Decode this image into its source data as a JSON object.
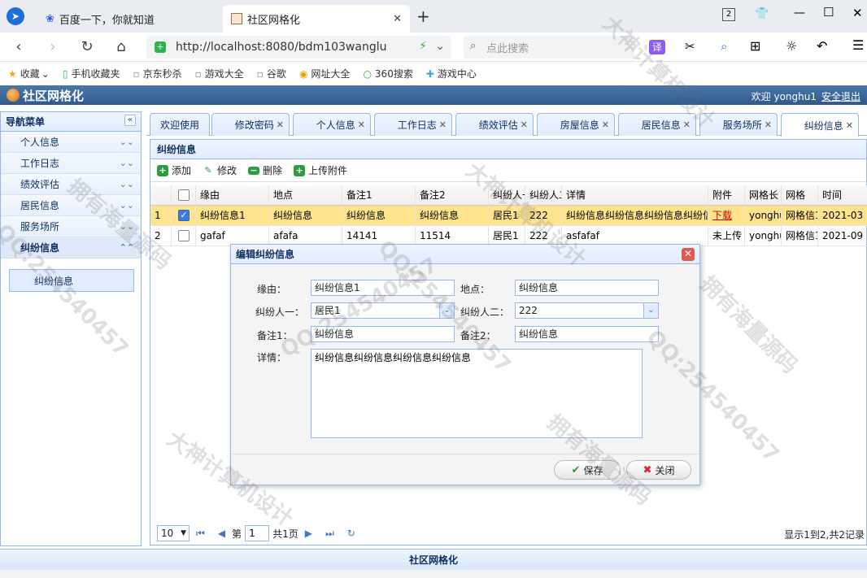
{
  "browser": {
    "tabs": [
      {
        "title": "百度一下，你就知道",
        "close": ""
      },
      {
        "title": "社区网格化",
        "close": "✕"
      }
    ],
    "new_tab": "+",
    "window_buttons": {
      "badge": "2",
      "minimize": "—",
      "maximize": "☐",
      "close": "✕"
    },
    "url": "http://localhost:8080/bdm103wanglu",
    "search_placeholder": "点此搜索",
    "translate": "译",
    "bookmarks": [
      "收藏",
      "手机收藏夹",
      "京东秒杀",
      "游戏大全",
      "谷歌",
      "网址大全",
      "360搜索",
      "游戏中心"
    ]
  },
  "app": {
    "title": "社区网格化",
    "welcome": "欢迎 yonghu1",
    "logout": "安全退出",
    "footer": "社区网格化"
  },
  "sidebar": {
    "header": "导航菜单",
    "collapse": "«",
    "items": [
      "个人信息",
      "工作日志",
      "绩效评估",
      "居民信息",
      "服务场所",
      "纠纷信息"
    ],
    "sub_item": "纠纷信息"
  },
  "tabs": [
    "欢迎使用",
    "修改密码",
    "个人信息",
    "工作日志",
    "绩效评估",
    "房屋信息",
    "居民信息",
    "服务场所",
    "纠纷信息"
  ],
  "tab_close": "✕",
  "panel": {
    "title": "纠纷信息",
    "toolbar": [
      "添加",
      "修改",
      "删除",
      "上传附件"
    ]
  },
  "grid": {
    "columns": [
      "",
      "缘由",
      "地点",
      "备注1",
      "备注2",
      "纠纷人一",
      "纠纷人二",
      "详情",
      "附件",
      "网格长",
      "网格",
      "时间"
    ],
    "rows": [
      {
        "no": "1",
        "checked": true,
        "cells": [
          "纠纷信息1",
          "纠纷信息",
          "纠纷信息",
          "纠纷信息",
          "居民1",
          "222",
          "纠纷信息纠纷信息纠纷信息纠纷信息",
          "下载",
          "yonghu1",
          "网格信1",
          "2021-03"
        ]
      },
      {
        "no": "2",
        "checked": false,
        "cells": [
          "gafaf",
          "afafa",
          "14141",
          "11514",
          "居民1",
          "222",
          "asfafaf",
          "未上传",
          "yonghu1",
          "网格信1",
          "2021-09"
        ]
      }
    ]
  },
  "pager": {
    "page_size": "10",
    "page_label": "第",
    "page_value": "1",
    "total_pages": "共1页",
    "info": "显示1到2,共2记录"
  },
  "dialog": {
    "title": "编辑纠纷信息",
    "close": "✕",
    "fields": {
      "reason_label": "缘由：",
      "reason": "纠纷信息1",
      "place_label": "地点：",
      "place": "纠纷信息",
      "party1_label": "纠纷人一：",
      "party1": "居民1",
      "party2_label": "纠纷人二：",
      "party2": "222",
      "note1_label": "备注1：",
      "note1": "纠纷信息",
      "note2_label": "备注2：",
      "note2": "纠纷信息",
      "detail_label": "详情：",
      "detail": "纠纷信息纠纷信息纠纷信息纠纷信息"
    },
    "save": "保存",
    "cancel": "关闭"
  },
  "watermarks": [
    "QQ:254540457",
    "大神计算机设计",
    "拥有海量源码",
    "QQ:254540457",
    "大神计算机设计",
    "拥有海量源码",
    "QQ:254540457",
    "大神计算机设计",
    "拥有海量源码",
    "QQ:254540457"
  ],
  "colors": {
    "accent": "#95b8e7",
    "header": "#2e5a8e",
    "selected_row": "#ffe48d"
  }
}
